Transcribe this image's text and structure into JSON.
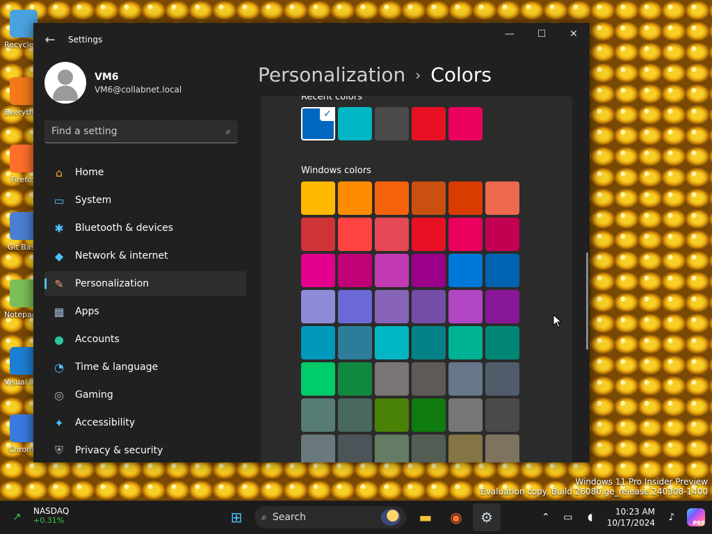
{
  "desktop_icons": [
    {
      "label": "Recycle Bin",
      "icon": "recycle-bin-icon",
      "color": "#4aa3df"
    },
    {
      "label": "Everything",
      "icon": "magnifier-icon",
      "color": "#f27a1a"
    },
    {
      "label": "Firefox",
      "icon": "firefox-icon",
      "color": "#ff6f2b"
    },
    {
      "label": "Git Bash",
      "icon": "git-bash-icon",
      "color": "#4a7fd4"
    },
    {
      "label": "Notepad++",
      "icon": "notepad-icon",
      "color": "#7bbf56"
    },
    {
      "label": "Visual Studio Code",
      "icon": "vscode-icon",
      "color": "#1e7fd2"
    },
    {
      "label": "Chrome",
      "icon": "chrome-icon",
      "color": "#3a7be0"
    }
  ],
  "window": {
    "title": "Settings",
    "back_icon": "back-arrow-icon",
    "controls": {
      "minimize": "—",
      "maximize": "☐",
      "close": "✕"
    }
  },
  "profile": {
    "name": "VM6",
    "email": "VM6@collabnet.local"
  },
  "search": {
    "placeholder": "Find a setting",
    "icon": "search-icon"
  },
  "nav": [
    {
      "label": "Home",
      "icon": "home-icon",
      "glyph": "⌂",
      "color": "#f5a623"
    },
    {
      "label": "System",
      "icon": "monitor-icon",
      "glyph": "▭",
      "color": "#4cc2ff"
    },
    {
      "label": "Bluetooth & devices",
      "icon": "bluetooth-icon",
      "glyph": "✱",
      "color": "#4cc2ff"
    },
    {
      "label": "Network & internet",
      "icon": "wifi-icon",
      "glyph": "◆",
      "color": "#4cc2ff"
    },
    {
      "label": "Personalization",
      "icon": "brush-icon",
      "glyph": "✎",
      "color": "#f0a070"
    },
    {
      "label": "Apps",
      "icon": "apps-icon",
      "glyph": "▦",
      "color": "#9fb4d6"
    },
    {
      "label": "Accounts",
      "icon": "person-icon",
      "glyph": "●",
      "color": "#2ec4a0"
    },
    {
      "label": "Time & language",
      "icon": "globe-clock-icon",
      "glyph": "◔",
      "color": "#4cc2ff"
    },
    {
      "label": "Gaming",
      "icon": "gamepad-icon",
      "glyph": "◎",
      "color": "#b0b0b0"
    },
    {
      "label": "Accessibility",
      "icon": "accessibility-icon",
      "glyph": "✦",
      "color": "#4cc2ff"
    },
    {
      "label": "Privacy & security",
      "icon": "shield-icon",
      "glyph": "⛨",
      "color": "#b0b0b0"
    }
  ],
  "active_nav": "Personalization",
  "breadcrumb": {
    "parent": "Personalization",
    "separator": "›",
    "current": "Colors"
  },
  "recent_colors": {
    "title": "Recent colors",
    "selected_index": 0,
    "colors": [
      "#0067c0",
      "#00b7c3",
      "#4a4a4a",
      "#e81123",
      "#ea005e"
    ]
  },
  "windows_colors": {
    "title": "Windows colors",
    "colors": [
      "#ffb900",
      "#ff8c00",
      "#f7630c",
      "#ca5010",
      "#da3b01",
      "#ef6950",
      "#d13438",
      "#ff4343",
      "#e74856",
      "#e81123",
      "#ea005e",
      "#c30052",
      "#e3008c",
      "#bf0077",
      "#c239b3",
      "#9a0089",
      "#0078d7",
      "#0063b1",
      "#8e8cd8",
      "#6b69d6",
      "#8764b8",
      "#744da9",
      "#b146c2",
      "#881798",
      "#0099bc",
      "#2d7d9a",
      "#00b7c3",
      "#038387",
      "#00b294",
      "#018574",
      "#00cc6a",
      "#10893e",
      "#7a7574",
      "#5d5a58",
      "#68768a",
      "#515c6b",
      "#567c73",
      "#486860",
      "#498205",
      "#107c10",
      "#767676",
      "#4c4a48",
      "#69797e",
      "#4a5459",
      "#647c64",
      "#525e54",
      "#847545",
      "#7e735f"
    ]
  },
  "watermark": {
    "line1": "Windows 11 Pro Insider Preview",
    "line2": "Evaluation copy. Build 26080.ge_release.240308-1400"
  },
  "taskbar": {
    "widget": {
      "name": "NASDAQ",
      "change": "+0.31%",
      "icon": "stock-chart-icon"
    },
    "search_label": "Search",
    "apps": [
      {
        "name": "start-button",
        "icon": "windows-logo-icon",
        "glyph": "⊞",
        "color": "#4cc2ff",
        "active": false
      },
      {
        "name": "file-explorer",
        "icon": "folder-icon",
        "glyph": "▬",
        "color": "#f4c33a",
        "active": false
      },
      {
        "name": "firefox",
        "icon": "firefox-icon",
        "glyph": "◉",
        "color": "#ff6f2b",
        "active": false
      },
      {
        "name": "settings",
        "icon": "gear-icon",
        "glyph": "⚙",
        "color": "#cfd8e3",
        "active": true
      }
    ],
    "tray": {
      "chevron": "⌃",
      "network": "▭",
      "volume": "◖"
    },
    "time": "10:23 AM",
    "date": "10/17/2024",
    "notification_icon": "bell-icon",
    "copilot_badge": "PRE"
  }
}
